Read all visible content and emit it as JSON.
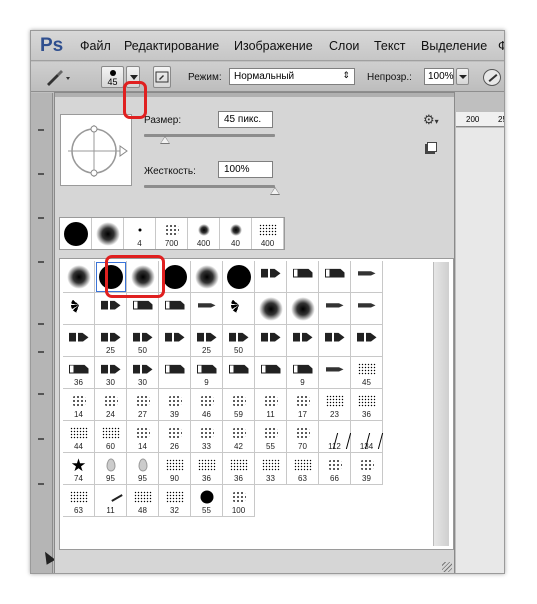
{
  "app": {
    "logo": "Ps",
    "menu": [
      "Файл",
      "Редактирование",
      "Изображение",
      "Слои",
      "Текст",
      "Выделение",
      "Ф"
    ]
  },
  "options_bar": {
    "brush_size": "45",
    "mode_label": "Режим:",
    "mode_value": "Нормальный",
    "opacity_label": "Непрозр.:",
    "opacity_value": "100%"
  },
  "brush_panel": {
    "size_label": "Размер:",
    "size_value": "45 пикс.",
    "size_slider_fraction": 0.16,
    "hardness_label": "Жесткость:",
    "hardness_value": "100%",
    "hardness_slider_fraction": 1.0,
    "recent_brushes": [
      {
        "icon": "hard-round",
        "label": ""
      },
      {
        "icon": "soft-round",
        "label": ""
      },
      {
        "icon": "dot",
        "label": "4"
      },
      {
        "icon": "scatter",
        "label": "700"
      },
      {
        "icon": "soft-round",
        "label": "400"
      },
      {
        "icon": "soft-round",
        "label": "40"
      },
      {
        "icon": "chunk",
        "label": "400"
      }
    ],
    "presets": [
      {
        "icon": "soft-round",
        "label": ""
      },
      {
        "icon": "hard-round",
        "label": ""
      },
      {
        "icon": "soft-round",
        "label": ""
      },
      {
        "icon": "hard-round",
        "label": ""
      },
      {
        "icon": "soft-round",
        "label": ""
      },
      {
        "icon": "hard-round",
        "label": ""
      },
      {
        "icon": "pen",
        "label": ""
      },
      {
        "icon": "pen2",
        "label": ""
      },
      {
        "icon": "pen2",
        "label": ""
      },
      {
        "icon": "pencil",
        "label": ""
      },
      {
        "icon": "fan",
        "label": ""
      },
      {
        "icon": "pen",
        "label": ""
      },
      {
        "icon": "pen2",
        "label": ""
      },
      {
        "icon": "pen2",
        "label": ""
      },
      {
        "icon": "pencil",
        "label": ""
      },
      {
        "icon": "fan",
        "label": ""
      },
      {
        "icon": "soft-round",
        "label": ""
      },
      {
        "icon": "soft-round",
        "label": ""
      },
      {
        "icon": "pencil",
        "label": ""
      },
      {
        "icon": "pencil",
        "label": ""
      },
      {
        "icon": "pen",
        "label": ""
      },
      {
        "icon": "pen",
        "label": "25"
      },
      {
        "icon": "pen",
        "label": "50"
      },
      {
        "icon": "pen",
        "label": ""
      },
      {
        "icon": "pen",
        "label": "25"
      },
      {
        "icon": "pen",
        "label": "50"
      },
      {
        "icon": "pen",
        "label": ""
      },
      {
        "icon": "pen",
        "label": ""
      },
      {
        "icon": "pen",
        "label": ""
      },
      {
        "icon": "pen",
        "label": ""
      },
      {
        "icon": "pen2",
        "label": "36"
      },
      {
        "icon": "pen",
        "label": "30"
      },
      {
        "icon": "pen",
        "label": "30"
      },
      {
        "icon": "pen2",
        "label": ""
      },
      {
        "icon": "pen2",
        "label": "9"
      },
      {
        "icon": "pen2",
        "label": ""
      },
      {
        "icon": "pen2",
        "label": ""
      },
      {
        "icon": "pen2",
        "label": "9"
      },
      {
        "icon": "pencil",
        "label": ""
      },
      {
        "icon": "chunk",
        "label": "45"
      },
      {
        "icon": "scatter",
        "label": "14"
      },
      {
        "icon": "scatter",
        "label": "24"
      },
      {
        "icon": "scatter",
        "label": "27"
      },
      {
        "icon": "scatter",
        "label": "39"
      },
      {
        "icon": "scatter",
        "label": "46"
      },
      {
        "icon": "scatter",
        "label": "59"
      },
      {
        "icon": "scatter",
        "label": "11"
      },
      {
        "icon": "scatter",
        "label": "17"
      },
      {
        "icon": "chunk",
        "label": "23"
      },
      {
        "icon": "chunk",
        "label": "36"
      },
      {
        "icon": "chunk",
        "label": "44"
      },
      {
        "icon": "chunk",
        "label": "60"
      },
      {
        "icon": "scatter",
        "label": "14"
      },
      {
        "icon": "scatter",
        "label": "26"
      },
      {
        "icon": "scatter",
        "label": "33"
      },
      {
        "icon": "scatter",
        "label": "42"
      },
      {
        "icon": "scatter",
        "label": "55"
      },
      {
        "icon": "scatter",
        "label": "70"
      },
      {
        "icon": "grass",
        "label": "112"
      },
      {
        "icon": "grass",
        "label": "134"
      },
      {
        "icon": "star",
        "label": "74"
      },
      {
        "icon": "drop",
        "label": "95"
      },
      {
        "icon": "drop",
        "label": "95"
      },
      {
        "icon": "chunk",
        "label": "90"
      },
      {
        "icon": "chunk",
        "label": "36"
      },
      {
        "icon": "chunk",
        "label": "36"
      },
      {
        "icon": "chunk",
        "label": "33"
      },
      {
        "icon": "chunk",
        "label": "63"
      },
      {
        "icon": "scatter",
        "label": "66"
      },
      {
        "icon": "scatter",
        "label": "39"
      },
      {
        "icon": "chunk",
        "label": "63"
      },
      {
        "icon": "stroke",
        "label": "11"
      },
      {
        "icon": "chunk",
        "label": "48"
      },
      {
        "icon": "chunk",
        "label": "32"
      },
      {
        "icon": "hard-round",
        "label": "55"
      },
      {
        "icon": "scatter",
        "label": "100"
      }
    ],
    "selected_preset_index": 1
  },
  "ruler": {
    "marks": [
      "200",
      "25"
    ]
  }
}
